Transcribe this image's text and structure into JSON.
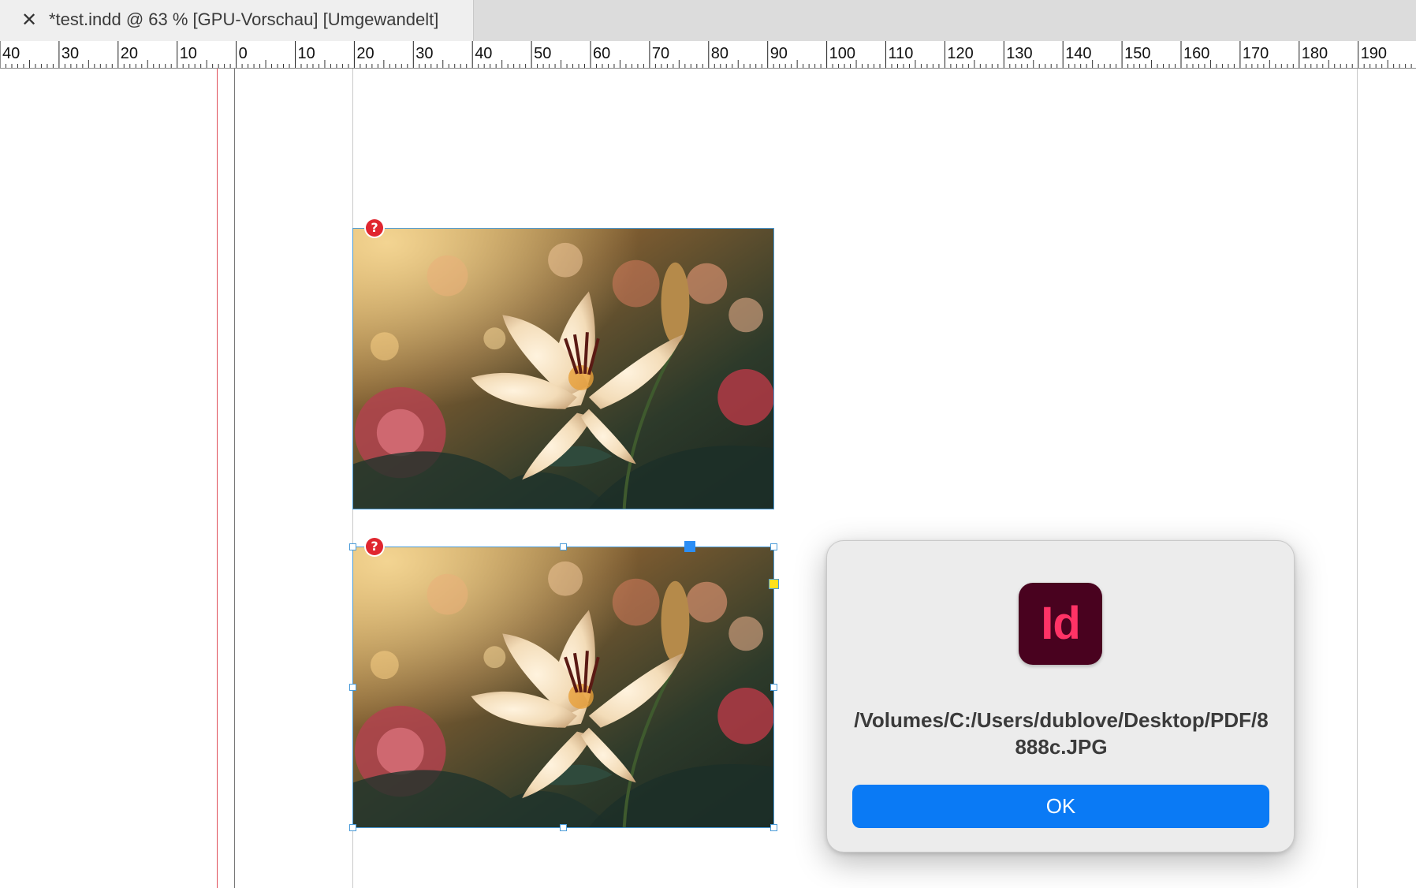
{
  "tab": {
    "close_glyph": "✕",
    "title": "*test.indd @ 63 % [GPU-Vorschau] [Umgewandelt]"
  },
  "ruler": {
    "labels": [
      "40",
      "30",
      "20",
      "10",
      "0",
      "10",
      "20",
      "30",
      "40",
      "50",
      "60",
      "70",
      "80",
      "90",
      "100",
      "110",
      "120",
      "130",
      "140",
      "150",
      "160",
      "170",
      "180",
      "190"
    ]
  },
  "frames": [
    {
      "status_icon": "missing-link-icon",
      "status_glyph": "?"
    },
    {
      "status_icon": "missing-link-icon",
      "status_glyph": "?"
    }
  ],
  "dialog": {
    "app_icon_text": "Id",
    "message": "/Volumes/C:/Users/dublove/Desktop/PDF/8888c.JPG",
    "ok_label": "OK"
  },
  "colors": {
    "selection": "#4a9bd8",
    "bleed_guide": "#e0505a",
    "ok_button": "#0a7af5",
    "app_icon_bg": "#49021f",
    "app_icon_fg": "#ff3366"
  }
}
